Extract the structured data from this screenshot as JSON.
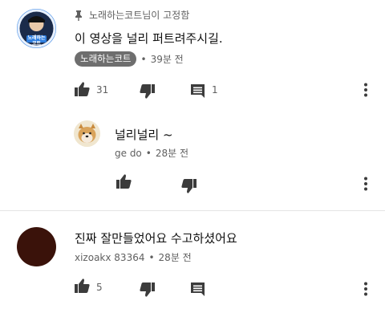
{
  "pinned_comment": {
    "pin_label": "노래하는코트님이 고정함",
    "text": "이 영상을 널리 퍼트려주시길.",
    "author_badge": "노래하는코트",
    "time": "39분 전",
    "like_count": "31",
    "reply_count": "1",
    "avatar_caption": "노래하는 코트"
  },
  "reply": {
    "text": "널리널리 ~",
    "author": "ge do",
    "time": "28분 전"
  },
  "comment2": {
    "text": "진짜 잘만들었어요 수고하셨어요",
    "author": "xizoakx 83364",
    "time": "28분 전",
    "like_count": "5"
  },
  "colors": {
    "avatar_ring": "#2f7fe0",
    "avatar_dark": "#3a120a",
    "pill_bg": "#6e6e6e"
  },
  "icons": [
    "pin-icon",
    "thumbs-up-icon",
    "thumbs-down-icon",
    "comment-icon",
    "more-vert-icon"
  ]
}
